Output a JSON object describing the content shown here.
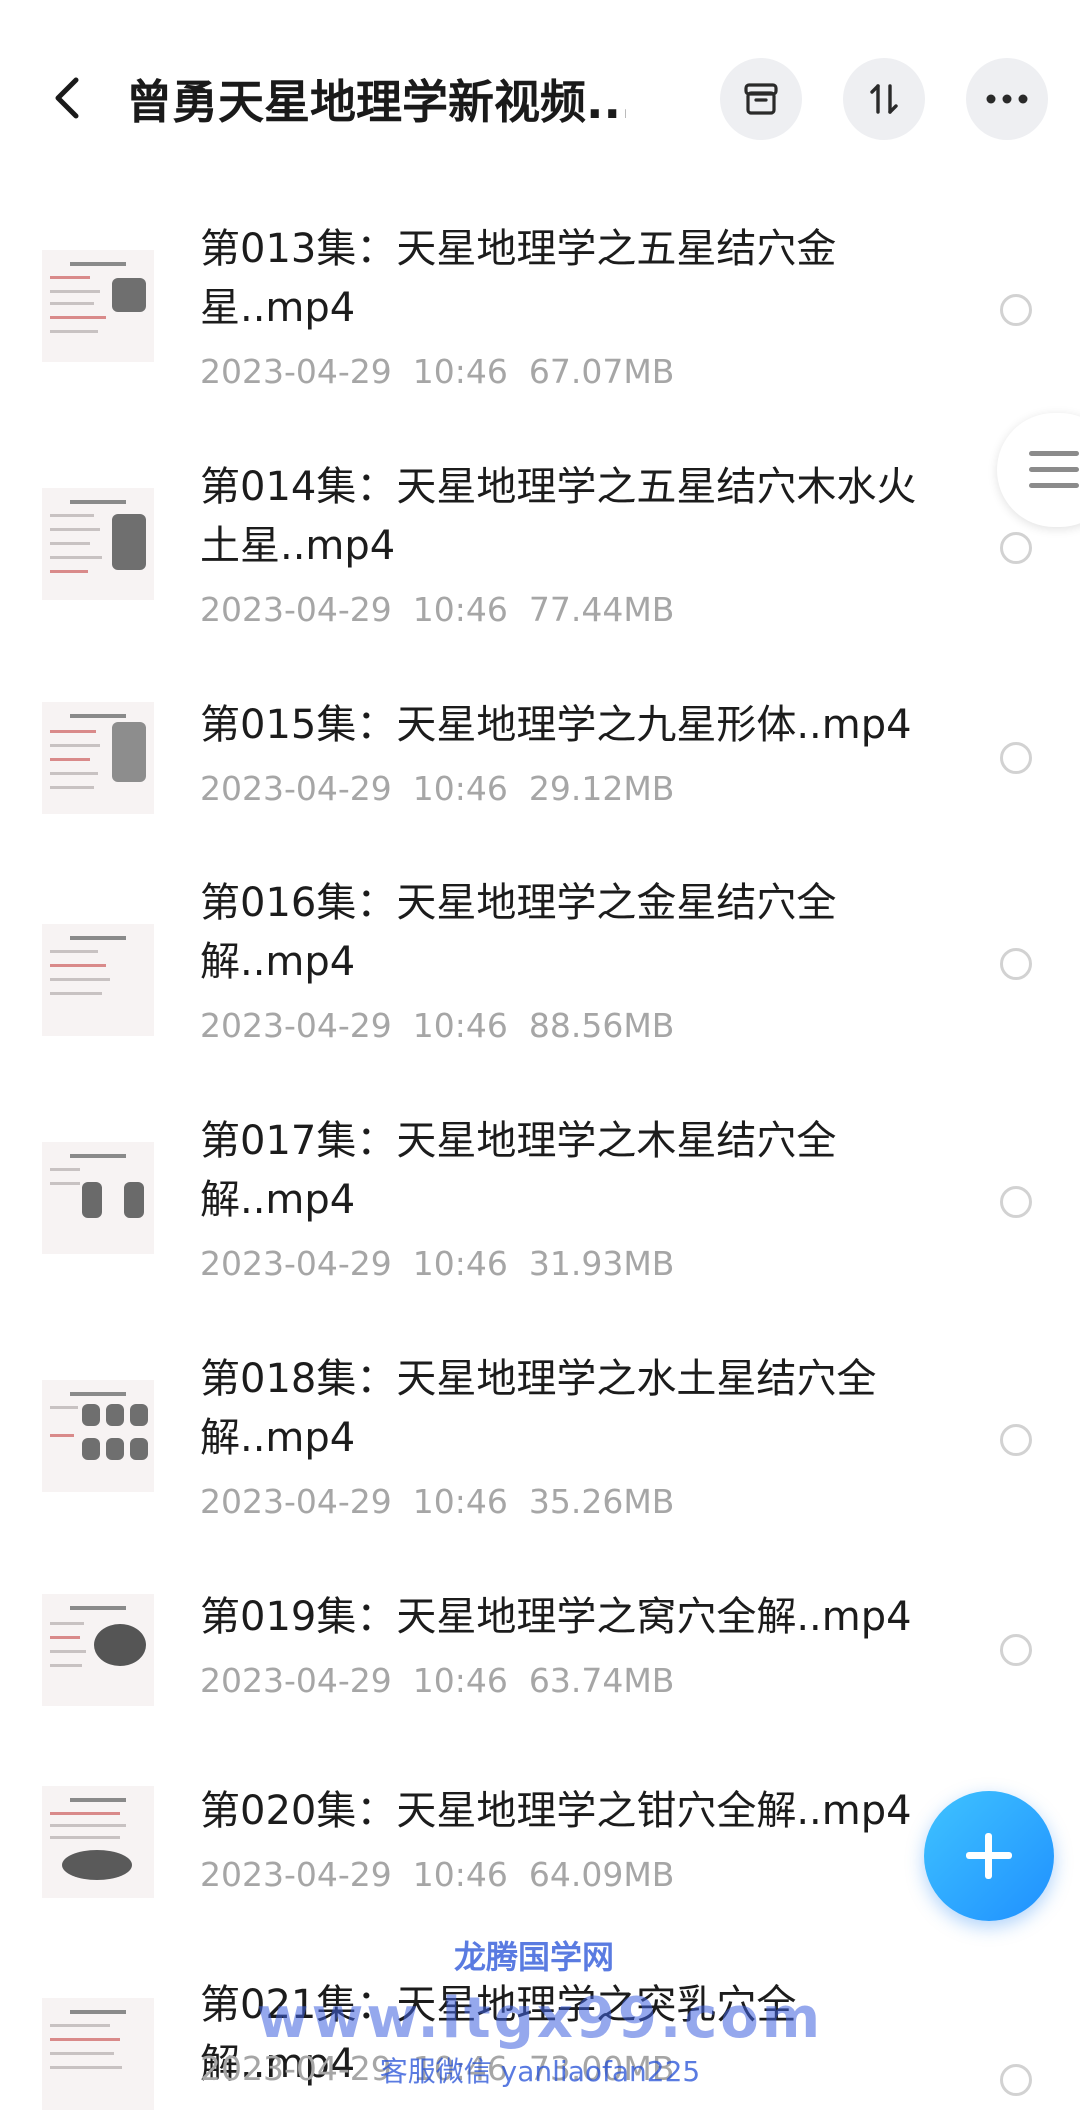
{
  "header": {
    "title": "曾勇天星地理学新视频...",
    "back_icon": "chevron-left-icon",
    "archive_icon": "archive-box-icon",
    "sort_icon": "sort-arrows-icon",
    "more_icon": "more-horizontal-icon"
  },
  "files": [
    {
      "name": "第013集：天星地理学之五星结穴金星..mp4",
      "date": "2023-04-29",
      "time": "10:46",
      "size": "67.07MB"
    },
    {
      "name": "第014集：天星地理学之五星结穴木水火土星..mp4",
      "date": "2023-04-29",
      "time": "10:46",
      "size": "77.44MB"
    },
    {
      "name": "第015集：天星地理学之九星形体..mp4",
      "date": "2023-04-29",
      "time": "10:46",
      "size": "29.12MB"
    },
    {
      "name": "第016集：天星地理学之金星结穴全解..mp4",
      "date": "2023-04-29",
      "time": "10:46",
      "size": "88.56MB"
    },
    {
      "name": "第017集：天星地理学之木星结穴全解..mp4",
      "date": "2023-04-29",
      "time": "10:46",
      "size": "31.93MB"
    },
    {
      "name": "第018集：天星地理学之水土星结穴全解..mp4",
      "date": "2023-04-29",
      "time": "10:46",
      "size": "35.26MB"
    },
    {
      "name": "第019集：天星地理学之窝穴全解..mp4",
      "date": "2023-04-29",
      "time": "10:46",
      "size": "63.74MB"
    },
    {
      "name": "第020集：天星地理学之钳穴全解..mp4",
      "date": "2023-04-29",
      "time": "10:46",
      "size": "64.09MB"
    },
    {
      "name": "第021集：天星地理学之突乳穴全解..mp4",
      "date": "2023-04-29",
      "time": "10:46",
      "size": "73.00MB"
    }
  ],
  "fab_icon": "plus-icon",
  "side_handle_icon": "menu-lines-icon",
  "watermark": {
    "line1": "龙腾国学网",
    "line2": "www.ltgx99.com",
    "line3": "客服微信 yanliaofan225"
  },
  "colors": {
    "fab": "#2aa4ff",
    "watermark": "#2450d8",
    "meta_text": "#a6a6a6"
  }
}
